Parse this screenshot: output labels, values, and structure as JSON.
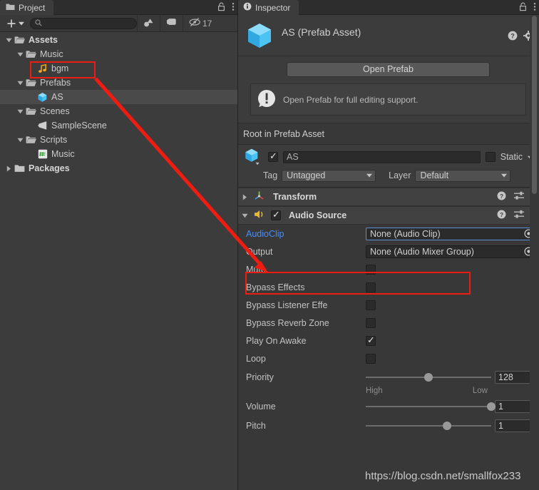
{
  "project": {
    "tab_label": "Project",
    "tab_icon": "folder-icon",
    "lock_icon": "lock-icon",
    "menu_icon": "kebab-menu-icon",
    "toolbar": {
      "add_label": "+",
      "add_dropdown_icon": "chevron-down-icon",
      "search_placeholder": "",
      "search_value": "",
      "search_icon": "search-icon",
      "filter_type_icon": "shapes-filter-icon",
      "filter_label_icon": "tag-filter-icon",
      "hidden_icon": "eye-slash-icon",
      "hidden_count": "17"
    },
    "tree": [
      {
        "label": "Assets",
        "indent": 0,
        "arrow": "down",
        "icon": "folder-open-icon",
        "bold": true,
        "selected": false
      },
      {
        "label": "Music",
        "indent": 1,
        "arrow": "down",
        "icon": "folder-open-icon",
        "bold": false,
        "selected": false
      },
      {
        "label": "bgm",
        "indent": 2,
        "arrow": "none",
        "icon": "audio-clip-icon",
        "bold": false,
        "selected": false
      },
      {
        "label": "Prefabs",
        "indent": 1,
        "arrow": "down",
        "icon": "folder-open-icon",
        "bold": false,
        "selected": false
      },
      {
        "label": "AS",
        "indent": 2,
        "arrow": "none",
        "icon": "prefab-cube-icon",
        "bold": false,
        "selected": true
      },
      {
        "label": "Scenes",
        "indent": 1,
        "arrow": "down",
        "icon": "folder-open-icon",
        "bold": false,
        "selected": false
      },
      {
        "label": "SampleScene",
        "indent": 2,
        "arrow": "none",
        "icon": "unity-scene-icon",
        "bold": false,
        "selected": false
      },
      {
        "label": "Scripts",
        "indent": 1,
        "arrow": "down",
        "icon": "folder-open-icon",
        "bold": false,
        "selected": false
      },
      {
        "label": "Music",
        "indent": 2,
        "arrow": "none",
        "icon": "csharp-script-icon",
        "bold": false,
        "selected": false
      },
      {
        "label": "Packages",
        "indent": 0,
        "arrow": "right",
        "icon": "folder-icon",
        "bold": true,
        "selected": false
      }
    ]
  },
  "inspector": {
    "tab_label": "Inspector",
    "tab_icon": "info-icon",
    "lock_icon": "lock-icon",
    "menu_icon": "kebab-menu-icon",
    "asset_title": "AS (Prefab Asset)",
    "asset_icon": "prefab-cube-icon",
    "help_icon": "help-circle-icon",
    "settings_icon": "gear-icon",
    "open_prefab_button": "Open Prefab",
    "helpbox": {
      "icon": "info-exclamation-icon",
      "text": "Open Prefab for full editing support."
    },
    "root_label": "Root in Prefab Asset",
    "gameobject": {
      "enabled": true,
      "name_value": "AS",
      "static_label": "Static",
      "static_checked": false,
      "static_dropdown_icon": "chevron-down-icon",
      "tag_label": "Tag",
      "tag_value": "Untagged",
      "layer_label": "Layer",
      "layer_value": "Default"
    },
    "components": [
      {
        "name": "Transform",
        "icon": "transform-axis-icon",
        "expanded": false,
        "has_enable_checkbox": false,
        "help_icon": "help-circle-icon",
        "preset_icon": "preset-sliders-icon",
        "menu_icon": "kebab-menu-icon"
      },
      {
        "name": "Audio Source",
        "icon": "audio-source-speaker-icon",
        "expanded": true,
        "has_enable_checkbox": true,
        "enabled": true,
        "help_icon": "help-circle-icon",
        "preset_icon": "preset-sliders-icon",
        "menu_icon": "kebab-menu-icon"
      }
    ],
    "audio_source": {
      "object_fields": [
        {
          "label": "AudioClip",
          "value": "None (Audio Clip)",
          "label_blue": true,
          "picker_icon": "object-picker-icon"
        },
        {
          "label": "Output",
          "value": "None (Audio Mixer Group)",
          "label_blue": false,
          "picker_icon": "object-picker-icon"
        }
      ],
      "toggles": [
        {
          "label": "Mute",
          "checked": false
        },
        {
          "label": "Bypass Effects",
          "checked": false
        },
        {
          "label": "Bypass Listener Effe",
          "checked": false
        },
        {
          "label": "Bypass Reverb Zone",
          "checked": false
        },
        {
          "label": "Play On Awake",
          "checked": true
        },
        {
          "label": "Loop",
          "checked": false
        }
      ],
      "sliders": [
        {
          "label": "Priority",
          "value": "128",
          "fill": 0.5,
          "left_hint": "High",
          "right_hint": "Low"
        },
        {
          "label": "Volume",
          "value": "1",
          "fill": 1.0,
          "left_hint": "",
          "right_hint": ""
        },
        {
          "label": "Pitch",
          "value": "1",
          "fill": 0.65,
          "left_hint": "",
          "right_hint": ""
        }
      ]
    }
  },
  "annotations": {
    "highlight_color": "#ee1c11",
    "watermark": "https://blog.csdn.net/smallfox233",
    "arrow_from": "bgm asset in project tree",
    "arrow_to": "AudioClip property field"
  }
}
